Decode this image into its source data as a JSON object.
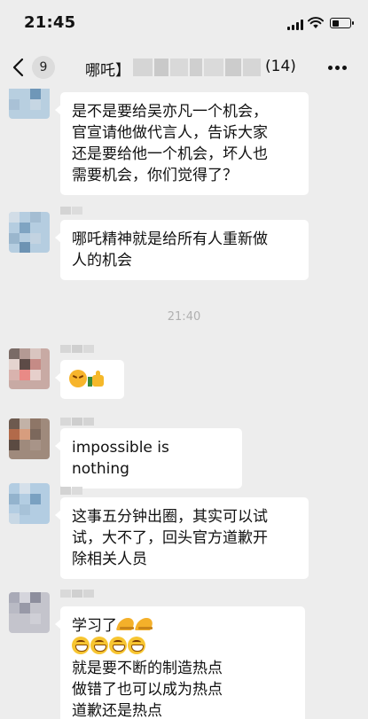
{
  "status_bar": {
    "time": "21:45"
  },
  "nav": {
    "back_count": "9",
    "title_visible": "哪吒】",
    "member_count": "(14)"
  },
  "messages": [
    {
      "type": "text",
      "text": "是不是要给吴亦凡一个机会，\n官宣请他做代言人，告诉大家\n还是要给他一个机会，坏人也\n需要机会，你们觉得了？"
    },
    {
      "type": "text",
      "text": "哪吒精神就是给所有人重新做\n人的机会"
    },
    {
      "type": "time",
      "text": "21:40"
    },
    {
      "type": "emoji",
      "emojis": [
        "angry-face-icon",
        "thumbs-up-icon"
      ]
    },
    {
      "type": "text",
      "text": "impossible is nothing"
    },
    {
      "type": "text",
      "text": "这事五分钟出圈，其实可以试\n试，大不了，回头官方道歉开\n除相关人员"
    },
    {
      "type": "mixed",
      "line1": "学习了",
      "line1_emojis": [
        "bow-icon",
        "bow-icon"
      ],
      "line2_emojis": [
        "grinning-face-icon",
        "grinning-face-icon",
        "grinning-face-icon",
        "grinning-face-icon"
      ],
      "rest": "就是要不断的制造热点\n做错了也可以成为热点\n道歉还是热点"
    }
  ],
  "colors": {
    "background": "#ededed",
    "bubble": "#ffffff",
    "timestamp": "#b0b0b0"
  }
}
